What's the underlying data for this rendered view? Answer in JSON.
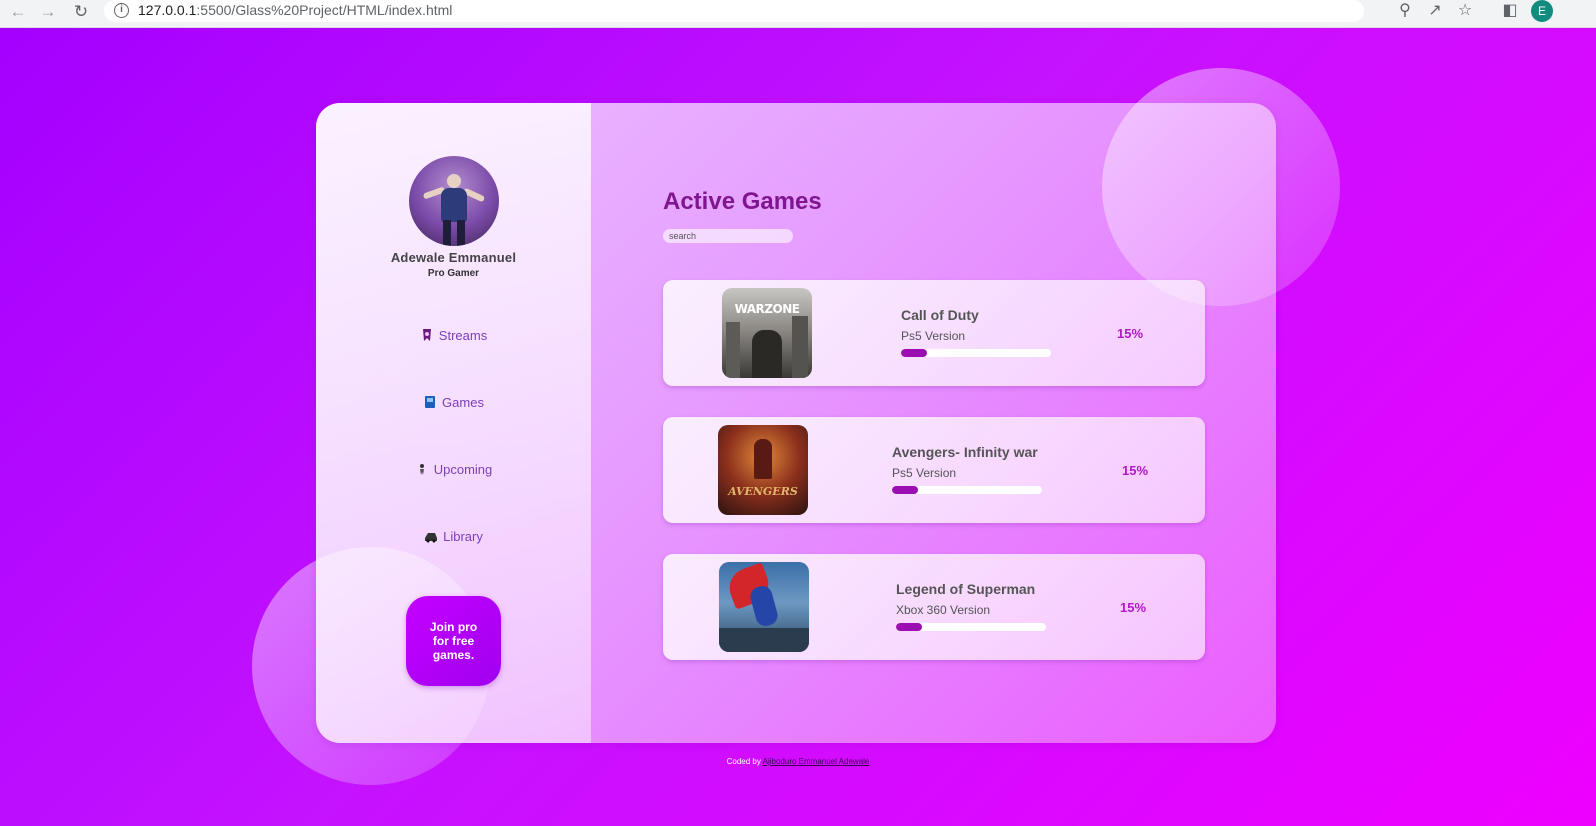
{
  "browser": {
    "url_host": "127.0.0.1",
    "url_path": ":5500/Glass%20Project/HTML/index.html",
    "profile_initial": "E"
  },
  "sidebar": {
    "user_name": "Adewale Emmanuel",
    "user_role": "Pro Gamer",
    "items": [
      {
        "label": "Streams",
        "icon": "streams-icon"
      },
      {
        "label": "Games",
        "icon": "games-icon"
      },
      {
        "label": "Upcoming",
        "icon": "upcoming-icon"
      },
      {
        "label": "Library",
        "icon": "library-icon"
      }
    ],
    "cta_label": "Join pro for free games."
  },
  "main": {
    "title": "Active Games",
    "search_placeholder": "search",
    "games": [
      {
        "name": "Call of Duty",
        "version": "Ps5 Version",
        "percent_text": "15%",
        "progress": 0.17,
        "thumb_text": "WARZONE"
      },
      {
        "name": "Avengers- Infinity war",
        "version": "Ps5 Version",
        "percent_text": "15%",
        "progress": 0.17,
        "thumb_text": "AVENGERS"
      },
      {
        "name": "Legend of Superman",
        "version": "Xbox 360 Version",
        "percent_text": "15%",
        "progress": 0.17,
        "thumb_text": ""
      }
    ]
  },
  "footer": {
    "prefix": "Coded by ",
    "link_text": "Ajiboduro Emmanuel Adewale"
  },
  "colors": {
    "background_start": "#a400ff",
    "background_end": "#ee00ff",
    "title": "#7f168f",
    "progress_fill": "#9b0fb2",
    "percent": "#b218c8",
    "cta": "#c400ff"
  }
}
